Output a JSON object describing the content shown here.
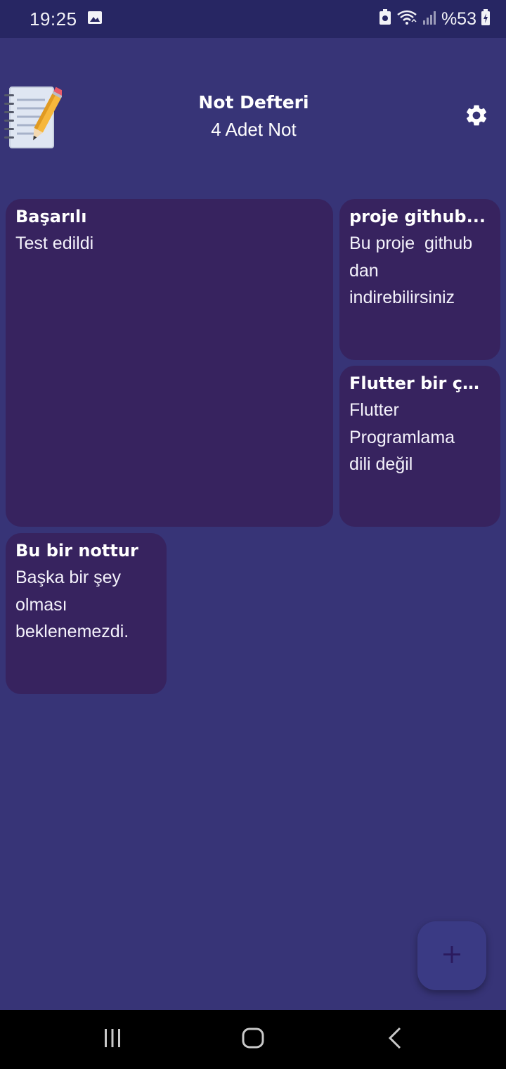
{
  "status_bar": {
    "time": "19:25",
    "battery": "%53",
    "icons": [
      "image-icon",
      "vpn-icon",
      "wifi-icon",
      "signal-icon",
      "battery-icon"
    ]
  },
  "header": {
    "title": "Not Defteri",
    "subtitle": "4 Adet Not",
    "logo_icon": "notepad-pencil-icon",
    "settings_icon": "gear-icon"
  },
  "notes": [
    {
      "title": "Başarılı",
      "body": "Test edildi"
    },
    {
      "title": "proje github...",
      "body": "Bu proje  github\ndan\nindirebilirsiniz"
    },
    {
      "title": "Flutter bir çe...",
      "body": "Flutter\nProgramlama\ndili değil"
    },
    {
      "title": "Bu bir nottur",
      "body": "Başka bir şey\nolması\nbeklenemezdi."
    }
  ],
  "fab": {
    "icon": "plus-icon"
  },
  "nav": {
    "icons": [
      "recent-apps-icon",
      "home-icon",
      "back-icon"
    ]
  },
  "colors": {
    "background": "#373477",
    "status_bar": "#272663",
    "card": "#37235f",
    "fab": "#3a3a84",
    "fab_icon": "#2b1a5e"
  }
}
